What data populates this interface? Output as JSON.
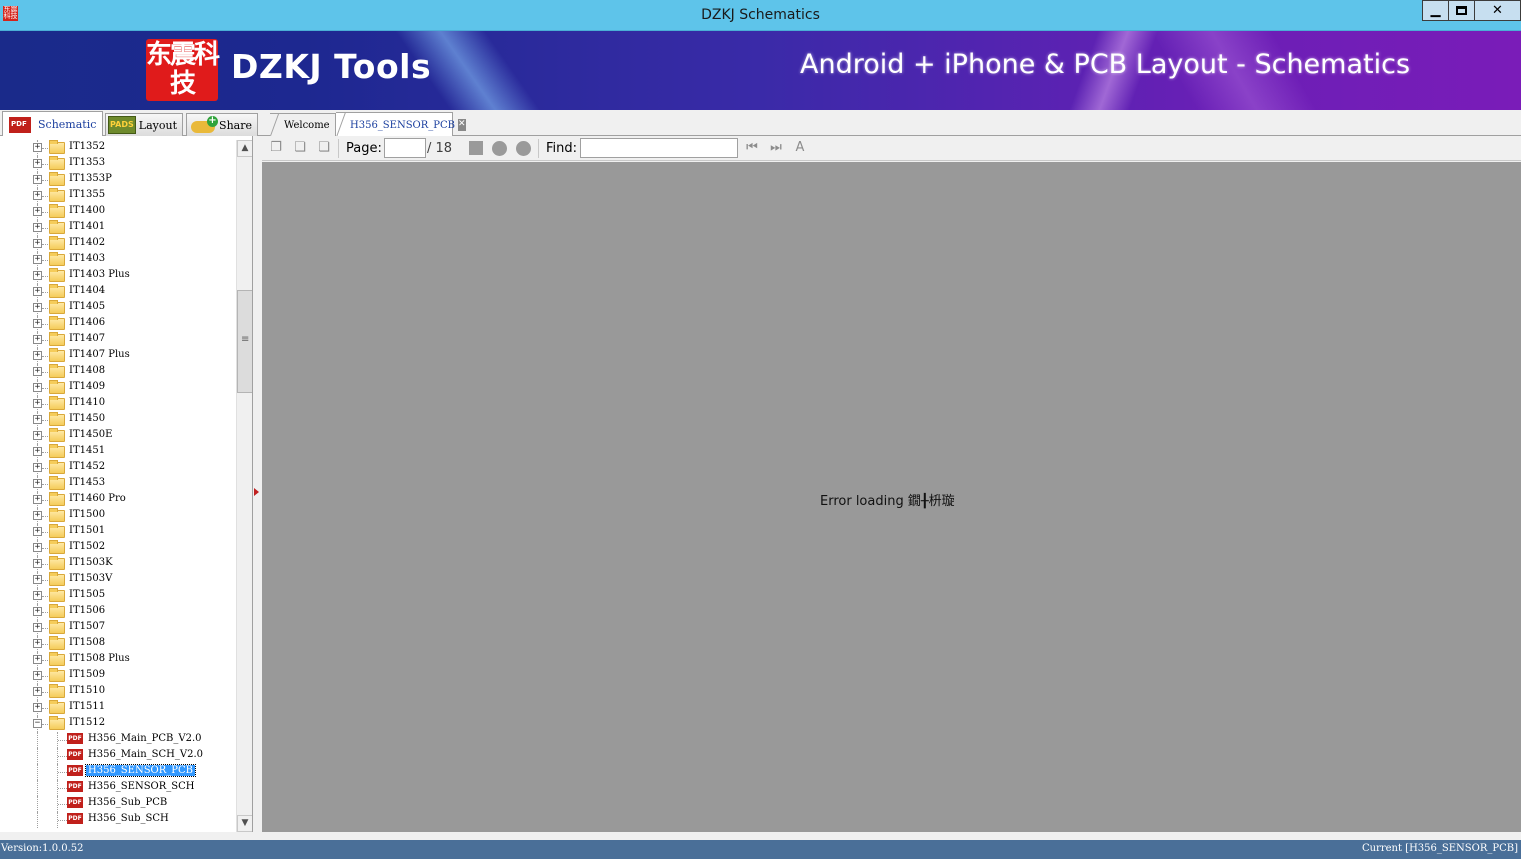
{
  "window": {
    "title": "DZKJ Schematics",
    "app_icon_text": "东震科技",
    "buttons": {
      "minimize": "▁",
      "close": "✕"
    }
  },
  "banner": {
    "logo_chars": "东震科技",
    "logo_text": "DZKJ Tools",
    "slogan": "Android + iPhone & PCB Layout - Schematics"
  },
  "left_tabs": [
    {
      "label": "Schematic",
      "icon": "pdf-icon",
      "active": true
    },
    {
      "label": "Layout",
      "icon": "pads-icon",
      "active": false
    },
    {
      "label": "Share",
      "icon": "cloud-add-icon",
      "active": false
    }
  ],
  "left_tab_icon_text": {
    "pdf": "PDF",
    "pads": "PADS"
  },
  "doc_tabs": [
    {
      "label": "Welcome",
      "active": false
    },
    {
      "label": "H356_SENSOR_PCB",
      "active": true,
      "closable": true
    }
  ],
  "tree": {
    "folders": [
      "IT1352",
      "IT1353",
      "IT1353P",
      "IT1355",
      "IT1400",
      "IT1401",
      "IT1402",
      "IT1403",
      "IT1403 Plus",
      "IT1404",
      "IT1405",
      "IT1406",
      "IT1407",
      "IT1407 Plus",
      "IT1408",
      "IT1409",
      "IT1410",
      "IT1450",
      "IT1450E",
      "IT1451",
      "IT1452",
      "IT1453",
      "IT1460 Pro",
      "IT1500",
      "IT1501",
      "IT1502",
      "IT1503K",
      "IT1503V",
      "IT1505",
      "IT1506",
      "IT1507",
      "IT1508",
      "IT1508 Plus",
      "IT1509",
      "IT1510",
      "IT1511"
    ],
    "expanded_folder": "IT1512",
    "files": [
      {
        "label": "H356_Main_PCB_V2.0",
        "selected": false
      },
      {
        "label": "H356_Main_SCH_V2.0",
        "selected": false
      },
      {
        "label": "H356_SENSOR_PCB",
        "selected": true
      },
      {
        "label": "H356_SENSOR_SCH",
        "selected": false
      },
      {
        "label": "H356_Sub_PCB",
        "selected": false
      },
      {
        "label": "H356_Sub_SCH",
        "selected": false
      }
    ],
    "file_icon_text": "PDF",
    "expand_symbol": "+",
    "collapse_symbol": "−",
    "scroll_up": "▲",
    "scroll_down": "▼",
    "scroll_grip": "≡"
  },
  "toolbar": {
    "page_label": "Page:",
    "page_value": "",
    "page_total": "/ 18",
    "find_label": "Find:",
    "find_value": ""
  },
  "viewer": {
    "message": "Error loading 鐗╂枡璇"
  },
  "status": {
    "version": "Version:1.0.0.52",
    "current": "Current [H356_SENSOR_PCB]"
  }
}
